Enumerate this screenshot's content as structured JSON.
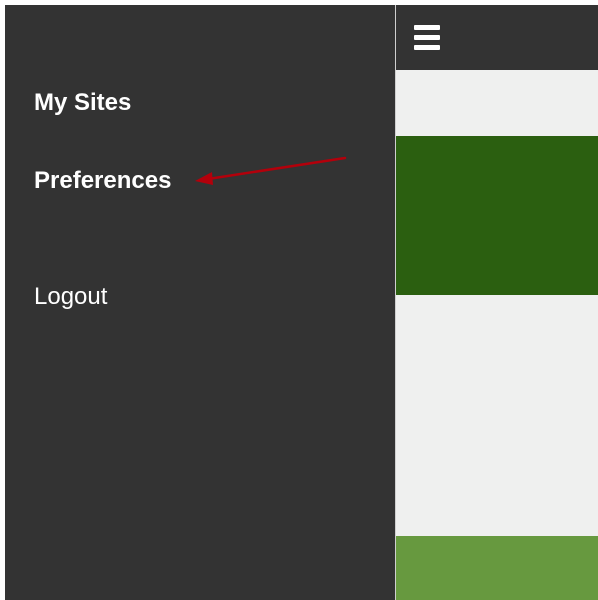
{
  "drawer": {
    "items": [
      {
        "label": "My Sites"
      },
      {
        "label": "Preferences"
      },
      {
        "label": "Logout"
      }
    ]
  },
  "topbar": {
    "menu_icon": "hamburger-menu-icon"
  },
  "colors": {
    "drawer_bg": "#333333",
    "content_bg": "#eff0ef",
    "dark_green": "#2b5f10",
    "light_green": "#67993f",
    "annotation_arrow": "#b3000b"
  }
}
